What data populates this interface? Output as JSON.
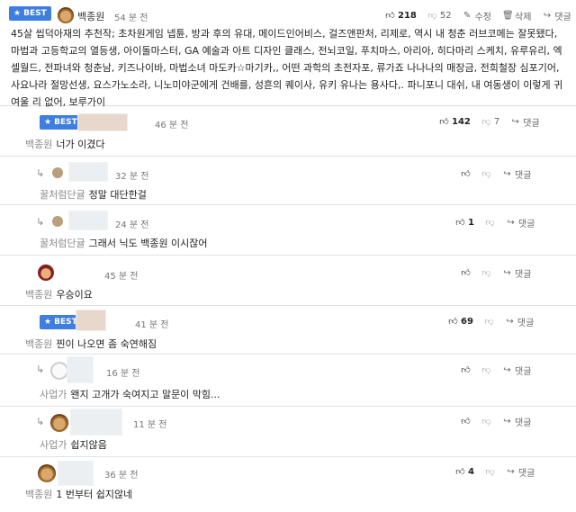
{
  "post": {
    "badge": "BEST",
    "author": "백종원",
    "time": "54 분 전",
    "likes": "218",
    "dislikes": "52",
    "edit_label": "수정",
    "delete_label": "삭제",
    "reply_label": "댓글",
    "content": "45살 씹덕아재의 추천작; 초차원게임 넵튠, 방과 후의 유대, 메이드인어비스, 걸즈앤판처, 리제로, 역시 내 청춘 러브코메는 잘못됐다, 마법과 고등학교의 열등생, 아이돌마스터, GA 예술과 아트 디자인 클래스, 전뇌코일, 푸치마스, 아리아, 히다마리 스케치, 유루유리, 엑셀월드, 전파녀와 청춘남, 키즈나이바, 마법소녀 마도카☆마기카,, 어떤 과학의 초전자포, 류가죠 나나나의 매장금, 전희철장 심포기어, 사요나라 절망선생, 요스가노소라, 니노미야군에게 건배를, 성흔의 퀘이사, 유키 유나는 용사다,. 파니포니 대쉬, 내 여동생이 이렇게 귀여울 리 없어, 보루가이"
  },
  "comments": [
    {
      "badge": "BEST",
      "time": "46 분 전",
      "likes": "142",
      "dislikes": "7",
      "reply_label": "댓글",
      "nick": "백종원",
      "text": "너가 이겼다"
    },
    {
      "time": "32 분 전",
      "reply_label": "댓글",
      "nick": "꿀처럼단귤",
      "text": "정말 대단한걸"
    },
    {
      "time": "24 분 전",
      "likes": "1",
      "reply_label": "댓글",
      "nick": "꿀처럼단귤",
      "text": "그래서 닉도 백종원 이시잖어"
    },
    {
      "time": "45 분 전",
      "reply_label": "댓글",
      "nick": "백종원",
      "text": "우승이요"
    },
    {
      "badge": "BEST",
      "time": "41 분 전",
      "likes": "69",
      "reply_label": "댓글",
      "nick": "백종원",
      "text": "찐이 나오면 좀 숙연해짐"
    },
    {
      "time": "16 분 전",
      "reply_label": "댓글",
      "nick": "사업가",
      "text": "왠지 고개가 숙여지고 말문이 막힘..."
    },
    {
      "time": "11 분 전",
      "reply_label": "댓글",
      "nick": "사업가",
      "text": "쉽지않음"
    },
    {
      "time": "36 분 전",
      "likes": "4",
      "reply_label": "댓글",
      "nick": "백종원",
      "text": "1 번부터 쉽지않네"
    }
  ]
}
